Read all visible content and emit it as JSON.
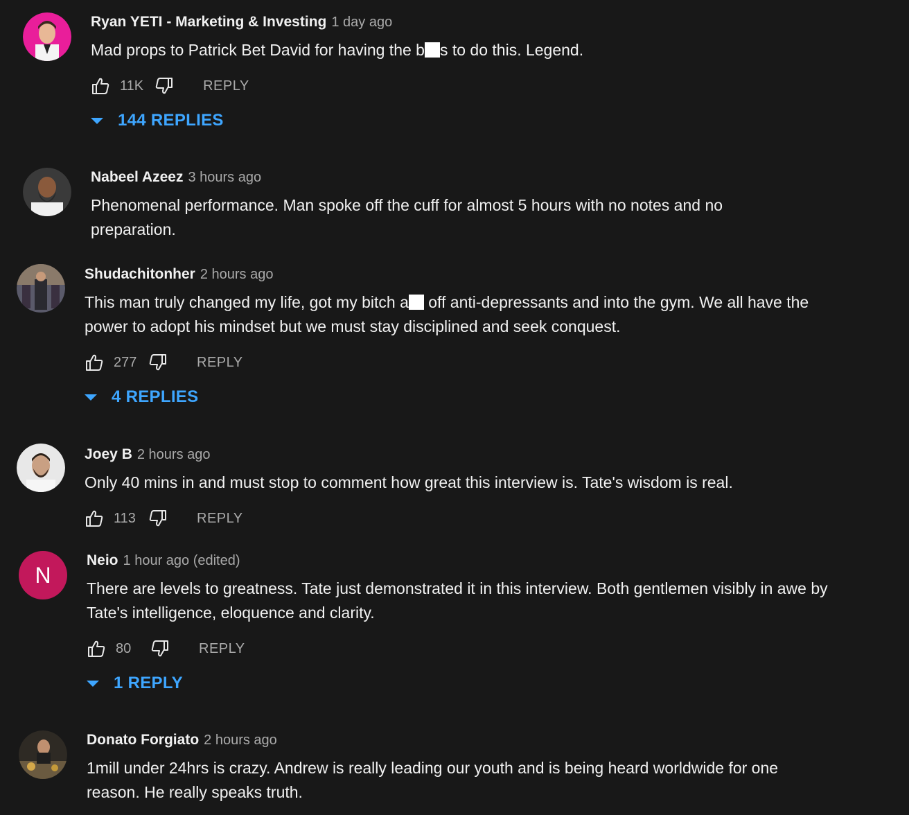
{
  "comments": [
    {
      "author": "Ryan YETI - Marketing & Investing",
      "time": "1 day ago",
      "text_before": "Mad props to Patrick Bet David for having the b",
      "text_after": "s to do this. Legend.",
      "likes": "11K",
      "reply_label": "REPLY",
      "replies_label": "144 REPLIES",
      "avatar_icon": "avatar-icon",
      "avatar_bg": "#e91e9a"
    },
    {
      "author": "Nabeel Azeez",
      "time": "3 hours ago",
      "text": "Phenomenal performance. Man spoke off the cuff for almost 5 hours with no notes and no preparation.",
      "avatar_icon": "avatar-icon"
    },
    {
      "author": "Shudachitonher",
      "time": "2 hours ago",
      "text_before": "This man truly changed my life, got my bitch a",
      "text_after": " off anti-depressants and into the gym. We all have the power to adopt his mindset but we must stay disciplined and seek conquest.",
      "likes": "277",
      "reply_label": "REPLY",
      "replies_label": "4 REPLIES",
      "avatar_icon": "avatar-icon"
    },
    {
      "author": "Joey B",
      "time": "2 hours ago",
      "text": "Only 40 mins in and must stop to comment how great this interview is. Tate's wisdom is real.",
      "likes": "113",
      "reply_label": "REPLY",
      "avatar_icon": "avatar-icon"
    },
    {
      "author": "Neio",
      "time": "1 hour ago (edited)",
      "text": "There are levels to greatness. Tate just demonstrated it in this interview. Both gentlemen visibly in awe by Tate's intelligence, eloquence and clarity.",
      "likes": "80",
      "reply_label": "REPLY",
      "replies_label": "1 REPLY",
      "avatar_letter": "N",
      "avatar_bg": "#c2185b"
    },
    {
      "author": "Donato Forgiato",
      "time": "2 hours ago",
      "text": "1mill under 24hrs is crazy. Andrew is really leading our youth and is being heard worldwide for one reason. He really speaks truth.",
      "avatar_icon": "avatar-icon"
    }
  ],
  "icons": {
    "like": "thumbs-up-icon",
    "dislike": "thumbs-down-icon",
    "expand": "caret-down-icon"
  },
  "colors": {
    "background": "#181818",
    "text": "#f1f1f1",
    "secondary": "#aaaaaa",
    "link": "#3ea6ff"
  }
}
